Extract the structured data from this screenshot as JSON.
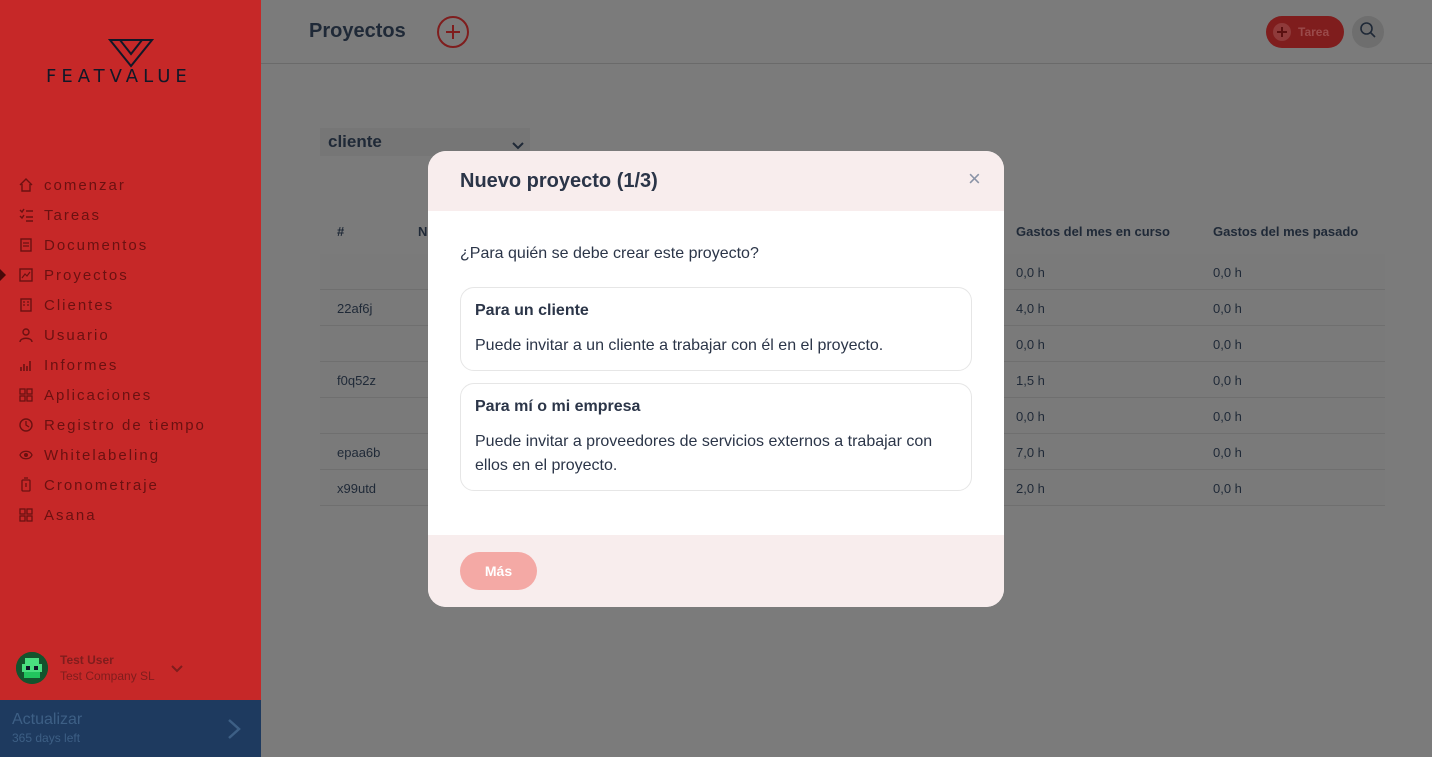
{
  "brand": {
    "logo_text": "FEATVALUE"
  },
  "sidebar": {
    "items": [
      {
        "label": "comenzar",
        "icon": "home-icon"
      },
      {
        "label": "Tareas",
        "icon": "tasks-icon"
      },
      {
        "label": "Documentos",
        "icon": "documents-icon"
      },
      {
        "label": "Proyectos",
        "icon": "projects-icon",
        "active": true
      },
      {
        "label": "Clientes",
        "icon": "clients-icon"
      },
      {
        "label": "Usuario",
        "icon": "user-icon"
      },
      {
        "label": "Informes",
        "icon": "reports-icon"
      },
      {
        "label": "Aplicaciones",
        "icon": "apps-icon"
      },
      {
        "label": "Registro de tiempo",
        "icon": "time-log-icon"
      },
      {
        "label": "Whitelabeling",
        "icon": "whitelabel-icon"
      },
      {
        "label": "Cronometraje",
        "icon": "stopwatch-icon"
      },
      {
        "label": "Asana",
        "icon": "asana-icon"
      }
    ],
    "user": {
      "name": "Test User",
      "company": "Test Company SL"
    },
    "upgrade": {
      "title": "Actualizar",
      "subtitle": "365 days left"
    }
  },
  "header": {
    "title": "Proyectos",
    "task_label": "Tarea"
  },
  "filter": {
    "selected": "cliente"
  },
  "table": {
    "headers": {
      "hash": "#",
      "name_partial": "N",
      "current_month": "Gastos del mes en curso",
      "last_month": "Gastos del mes pasado"
    },
    "rows": [
      {
        "id": "",
        "current": "0,0 h",
        "last": "0,0 h"
      },
      {
        "id": "22af6j",
        "current": "4,0 h",
        "last": "0,0 h"
      },
      {
        "id": "",
        "current": "0,0 h",
        "last": "0,0 h"
      },
      {
        "id": "f0q52z",
        "current": "1,5 h",
        "last": "0,0 h"
      },
      {
        "id": "",
        "current": "0,0 h",
        "last": "0,0 h"
      },
      {
        "id": "epaa6b",
        "current": "7,0 h",
        "last": "0,0 h"
      },
      {
        "id": "x99utd",
        "current": "2,0 h",
        "last": "0,0 h"
      }
    ]
  },
  "modal": {
    "title": "Nuevo proyecto (1/3)",
    "close": "×",
    "question": "¿Para quién se debe crear este proyecto?",
    "options": [
      {
        "title": "Para un cliente",
        "desc": "Puede invitar a un cliente a trabajar con él en el proyecto."
      },
      {
        "title": "Para mí o mi empresa",
        "desc": "Puede invitar a proveedores de servicios externos a trabajar con ellos en el proyecto."
      }
    ],
    "next_label": "Más"
  },
  "colors": {
    "sidebar": "#c62828",
    "accent": "#7f1d1d",
    "upgrade": "#1e3a5f",
    "overlay_dim": "#7b7b7b",
    "button_disabled": "#f4a9a5"
  }
}
